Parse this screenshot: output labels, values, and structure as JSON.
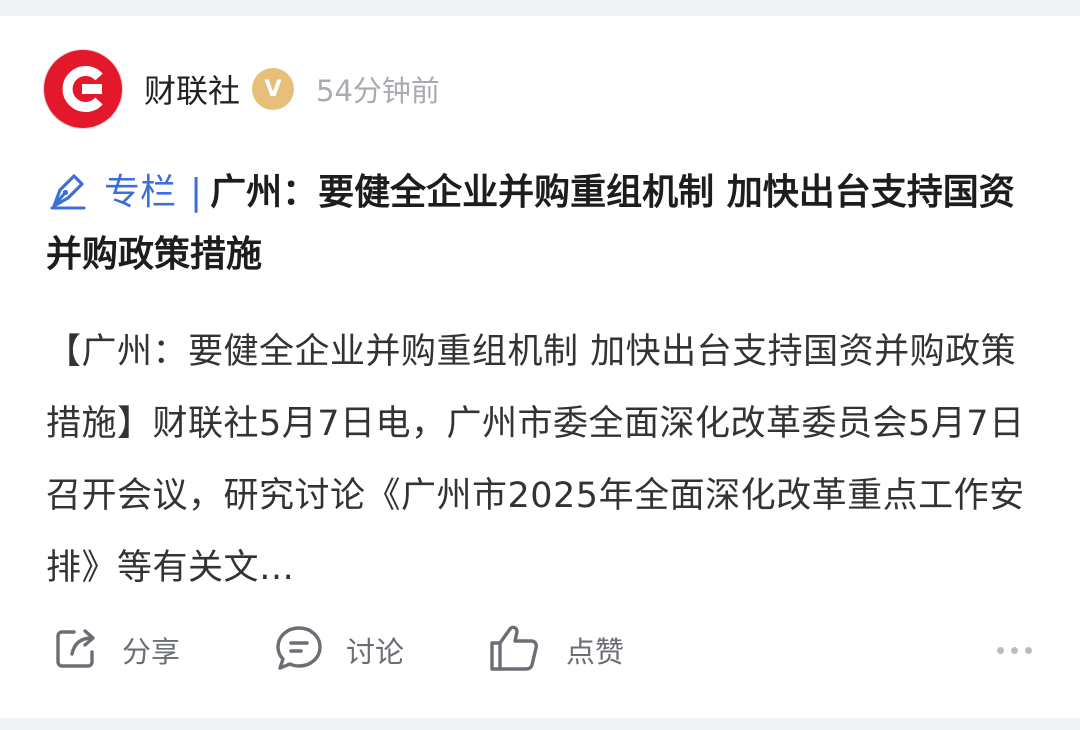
{
  "post": {
    "author": "财联社",
    "verified_badge": "V",
    "time": "54分钟前",
    "title": {
      "column_label": "专栏",
      "separator": "|",
      "text": "广州：要健全企业并购重组机制 加快出台支持国资并购政策措施"
    },
    "summary": "【广州：要健全企业并购重组机制 加快出台支持国资并购政策措施】财联社5月7日电，广州市委全面深化改革委员会5月7日召开会议，研究讨论《广州市2025年全面深化改革重点工作安排》等有关文…"
  },
  "actions": {
    "share": "分享",
    "discuss": "讨论",
    "like": "点赞"
  },
  "colors": {
    "brand_red": "#e3182b",
    "column_blue": "#3c6fd8",
    "verified_gold": "#e6c07a"
  },
  "icons": {
    "avatar": "cls-logo-icon",
    "column": "pen-nib-icon",
    "share": "share-icon",
    "discuss": "comment-icon",
    "like": "thumbs-up-icon",
    "more": "more-dots-icon"
  }
}
